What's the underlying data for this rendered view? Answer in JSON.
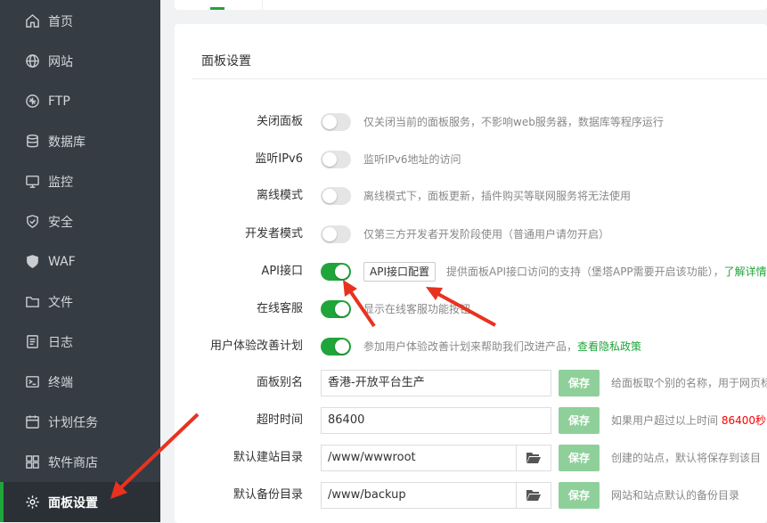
{
  "sidebar": {
    "items": [
      {
        "label": "首页",
        "icon": "home-icon"
      },
      {
        "label": "网站",
        "icon": "globe-icon"
      },
      {
        "label": "FTP",
        "icon": "ftp-icon"
      },
      {
        "label": "数据库",
        "icon": "database-icon"
      },
      {
        "label": "监控",
        "icon": "monitor-icon"
      },
      {
        "label": "安全",
        "icon": "shield-check-icon"
      },
      {
        "label": "WAF",
        "icon": "shield-icon"
      },
      {
        "label": "文件",
        "icon": "folder-icon"
      },
      {
        "label": "日志",
        "icon": "log-icon"
      },
      {
        "label": "终端",
        "icon": "terminal-icon"
      },
      {
        "label": "计划任务",
        "icon": "calendar-icon"
      },
      {
        "label": "软件商店",
        "icon": "grid-icon"
      },
      {
        "label": "面板设置",
        "icon": "gear-icon",
        "active": true
      }
    ]
  },
  "main": {
    "title": "面板设置",
    "settings": {
      "close_panel": {
        "label": "关闭面板",
        "enabled": false,
        "desc": "仅关闭当前的面板服务，不影响web服务器，数据库等程序运行"
      },
      "ipv6": {
        "label": "监听IPv6",
        "enabled": false,
        "desc": "监听IPv6地址的访问"
      },
      "offline": {
        "label": "离线模式",
        "enabled": false,
        "desc": "离线模式下，面板更新，插件购买等联网服务将无法使用"
      },
      "developer": {
        "label": "开发者模式",
        "enabled": false,
        "desc": "仅第三方开发者开发阶段使用（普通用户请勿开启）"
      },
      "api": {
        "label": "API接口",
        "enabled": true,
        "button": "API接口配置",
        "desc": "提供面板API接口访问的支持（堡塔APP需要开启该功能），",
        "link": "了解详情"
      },
      "online_service": {
        "label": "在线客服",
        "enabled": true,
        "desc": "显示在线客服功能按钮"
      },
      "ux_program": {
        "label": "用户体验改善计划",
        "enabled": true,
        "desc": "参加用户体验改善计划来帮助我们改进产品，",
        "link": "查看隐私政策"
      },
      "alias": {
        "label": "面板别名",
        "value": "香港-开放平台生产",
        "save": "保存",
        "desc": "给面板取个别的名称，用于网页标"
      },
      "timeout": {
        "label": "超时时间",
        "value": "86400",
        "save": "保存",
        "desc_prefix": "如果用户超过以上时间 ",
        "desc_highlight": "86400秒,"
      },
      "site_dir": {
        "label": "默认建站目录",
        "value": "/www/wwwroot",
        "save": "保存",
        "desc": "创建的站点，默认将保存到该目"
      },
      "backup_dir": {
        "label": "默认备份目录",
        "value": "/www/backup",
        "save": "保存",
        "desc": "网站和站点默认的备份目录"
      }
    }
  },
  "colors": {
    "accent": "#20a53a",
    "sidebar_bg": "#353c44",
    "save_btn": "#8fd09a",
    "arrow": "#e8321f"
  }
}
